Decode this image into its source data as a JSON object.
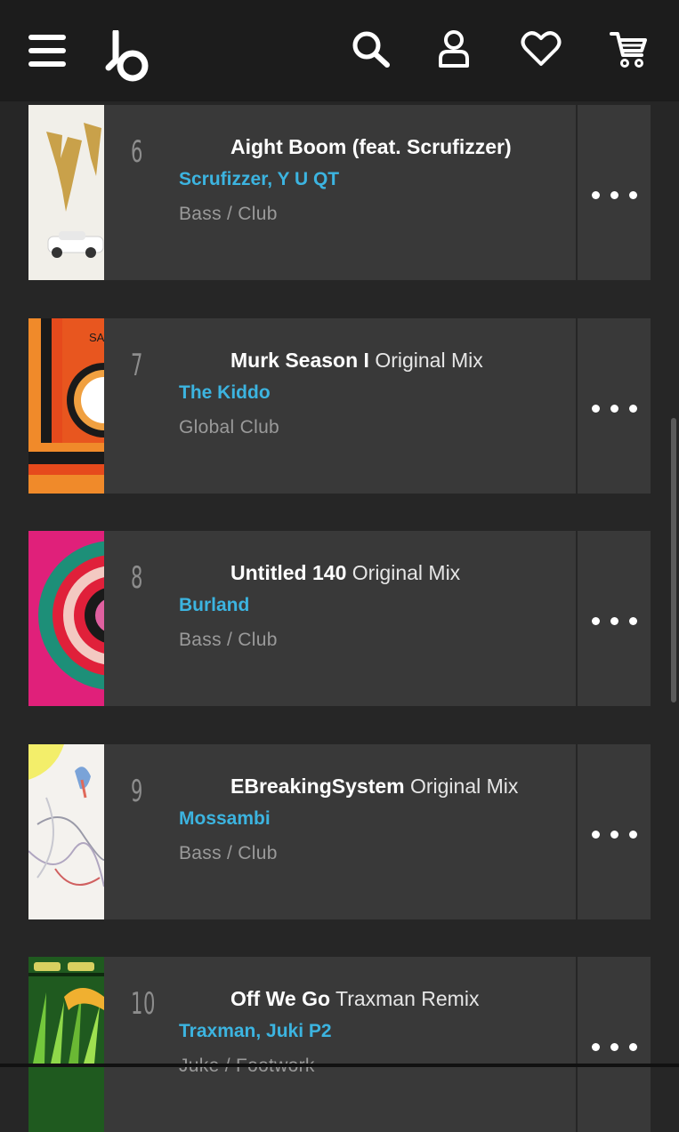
{
  "header": {
    "menu_icon": "hamburger-menu-icon",
    "logo_icon": "beatport-logo-icon",
    "search_icon": "search-icon",
    "account_icon": "user-icon",
    "favorites_icon": "heart-icon",
    "cart_icon": "cart-icon"
  },
  "colors": {
    "background": "#262626",
    "header": "#1c1c1c",
    "card": "#393939",
    "artist_link": "#3cb4e0",
    "genre_text": "#9a9a9a",
    "number_text": "#8d8d8d"
  },
  "tracks": [
    {
      "number": "6",
      "title": "Aight Boom (feat. Scrufizzer)",
      "mix": "",
      "artists": "Scrufizzer, Y U QT",
      "genre": "Bass / Club",
      "more_icon": "more-options-icon"
    },
    {
      "number": "7",
      "title": "Murk Season I",
      "mix": "Original Mix",
      "artists": "The Kiddo",
      "genre": "Global Club",
      "more_icon": "more-options-icon"
    },
    {
      "number": "8",
      "title": "Untitled 140",
      "mix": "Original Mix",
      "artists": "Burland",
      "genre": "Bass / Club",
      "more_icon": "more-options-icon"
    },
    {
      "number": "9",
      "title": "EBreakingSystem",
      "mix": "Original Mix",
      "artists": "Mossambi",
      "genre": "Bass / Club",
      "more_icon": "more-options-icon"
    },
    {
      "number": "10",
      "title": "Off We Go",
      "mix": "Traxman Remix",
      "artists": "Traxman, Juki P2",
      "genre": "Juke / Footwork",
      "more_icon": "more-options-icon"
    }
  ]
}
